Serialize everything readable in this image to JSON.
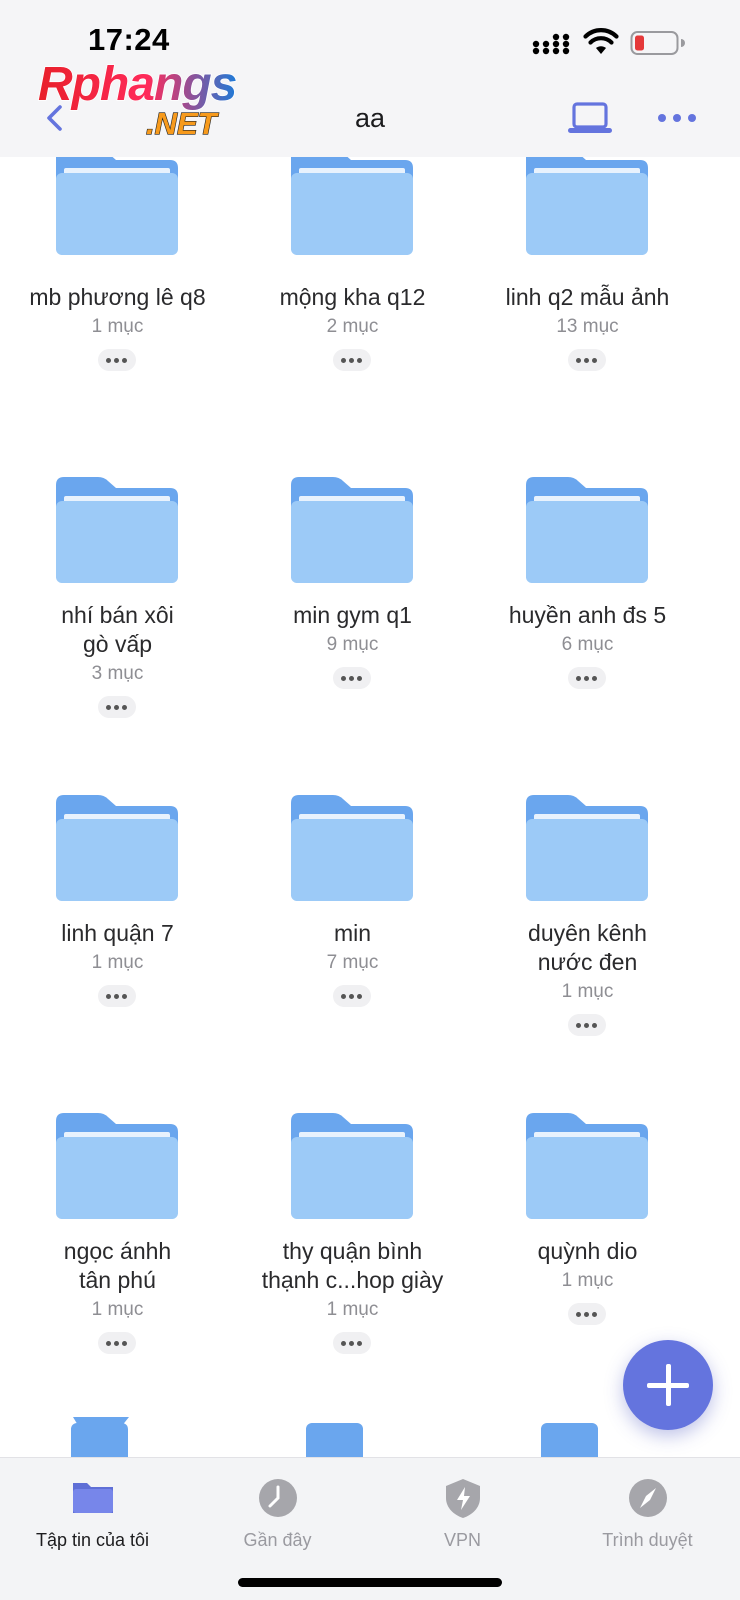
{
  "status_bar": {
    "time": "17:24"
  },
  "logo": {
    "line1": "Rphangs",
    "line2": ".NET"
  },
  "header": {
    "title": "aa",
    "icons": [
      "back-icon",
      "laptop-icon",
      "more-icon"
    ]
  },
  "folders": [
    {
      "name": "mb phương lê q8",
      "count": "1 mục"
    },
    {
      "name": "mộng kha q12",
      "count": "2 mục"
    },
    {
      "name": "linh q2 mẫu ảnh",
      "count": "13 mục"
    },
    {
      "name": "nhí bán xôi\ngò vấp",
      "count": "3 mục"
    },
    {
      "name": "min gym q1",
      "count": "9 mục"
    },
    {
      "name": "huyền anh đs 5",
      "count": "6 mục"
    },
    {
      "name": "linh quận 7",
      "count": "1 mục"
    },
    {
      "name": "min",
      "count": "7 mục"
    },
    {
      "name": "duyên kênh\nnước đen",
      "count": "1 mục"
    },
    {
      "name": "ngọc ánhh\ntân phú",
      "count": "1 mục"
    },
    {
      "name": "thy quận bình\nthạnh c...hop giày",
      "count": "1 mục"
    },
    {
      "name": "quỳnh dio",
      "count": "1 mục"
    }
  ],
  "tabs": [
    {
      "label": "Tập tin của tôi",
      "icon": "folder-icon",
      "active": true
    },
    {
      "label": "Gần đây",
      "icon": "clock-icon",
      "active": false
    },
    {
      "label": "VPN",
      "icon": "shield-icon",
      "active": false
    },
    {
      "label": "Trình duyệt",
      "icon": "compass-icon",
      "active": false
    }
  ],
  "colors": {
    "accent": "#6474de",
    "folder_back": "#6aa6ee",
    "folder_front": "#9ccaf7",
    "header_bg": "#f5f5f7",
    "battery_low": "#e5393a"
  }
}
